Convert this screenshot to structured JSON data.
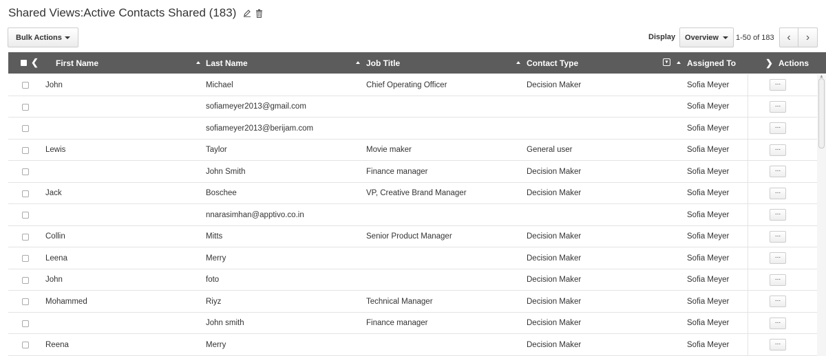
{
  "page": {
    "title": "Shared Views:Active Contacts Shared (183)"
  },
  "toolbar": {
    "bulk_actions_label": "Bulk Actions",
    "display_label": "Display",
    "display_value": "Overview",
    "pager_text": "1-50 of 183",
    "prev_label": "‹",
    "next_label": "›"
  },
  "columns": {
    "first_name": "First Name",
    "last_name": "Last Name",
    "job_title": "Job Title",
    "contact_type": "Contact Type",
    "assigned_to": "Assigned To",
    "actions": "Actions"
  },
  "rows": [
    {
      "first": "John",
      "last": "Michael",
      "job": "Chief Operating Officer",
      "type": "Decision Maker",
      "assigned": "Sofia Meyer"
    },
    {
      "first": "",
      "last": "sofiameyer2013@gmail.com",
      "job": "",
      "type": "",
      "assigned": "Sofia Meyer"
    },
    {
      "first": "",
      "last": "sofiameyer2013@berijam.com",
      "job": "",
      "type": "",
      "assigned": "Sofia Meyer"
    },
    {
      "first": "Lewis",
      "last": "Taylor",
      "job": "Movie maker",
      "type": "General user",
      "assigned": "Sofia Meyer"
    },
    {
      "first": "",
      "last": "John Smith",
      "job": "Finance manager",
      "type": "Decision Maker",
      "assigned": "Sofia Meyer"
    },
    {
      "first": "Jack",
      "last": "Boschee",
      "job": "VP, Creative Brand Manager",
      "type": "Decision Maker",
      "assigned": "Sofia Meyer"
    },
    {
      "first": "",
      "last": "nnarasimhan@apptivo.co.in",
      "job": "",
      "type": "",
      "assigned": "Sofia Meyer"
    },
    {
      "first": "Collin",
      "last": "Mitts",
      "job": "Senior Product Manager",
      "type": "Decision Maker",
      "assigned": "Sofia Meyer"
    },
    {
      "first": "Leena",
      "last": "Merry",
      "job": "",
      "type": "Decision Maker",
      "assigned": "Sofia Meyer"
    },
    {
      "first": "John",
      "last": "foto",
      "job": "",
      "type": "Decision Maker",
      "assigned": "Sofia Meyer"
    },
    {
      "first": "Mohammed",
      "last": "Riyz",
      "job": "Technical Manager",
      "type": "Decision Maker",
      "assigned": "Sofia Meyer"
    },
    {
      "first": "",
      "last": "John smith",
      "job": "Finance manager",
      "type": "Decision Maker",
      "assigned": "Sofia Meyer"
    },
    {
      "first": "Reena",
      "last": "Merry",
      "job": "",
      "type": "Decision Maker",
      "assigned": "Sofia Meyer"
    }
  ],
  "icons": {
    "edit": "pencil-icon",
    "delete": "trash-icon",
    "row_more": "ellipsis-icon",
    "filter": "filter-icon"
  },
  "colors": {
    "header_bg": "#5c5c5c",
    "row_border": "#e3e3e3"
  }
}
